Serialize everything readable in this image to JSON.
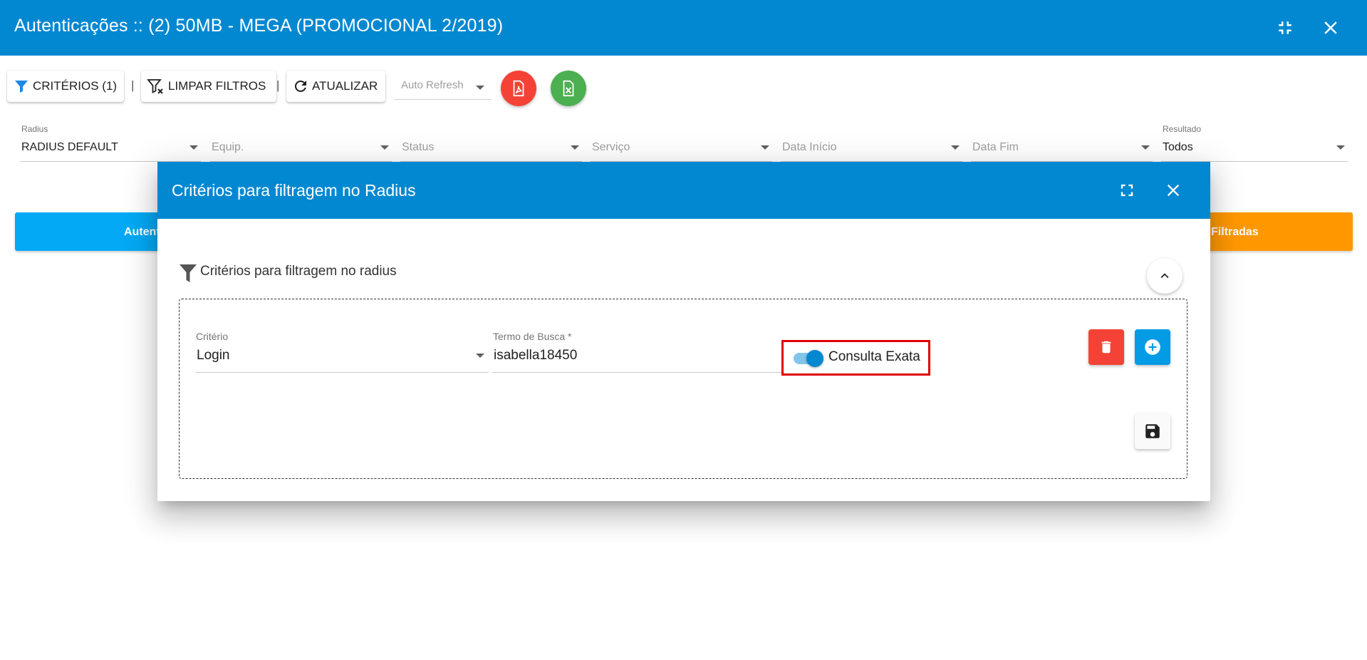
{
  "window": {
    "title": "Autenticações :: (2) 50MB - MEGA (PROMOCIONAL 2/2019)",
    "minimize_icon": "compress-icon",
    "close_icon": "close-icon"
  },
  "toolbar": {
    "criteria_label": "CRITÉRIOS (1)",
    "separator": "|",
    "clear_filters_label": "LIMPAR FILTROS",
    "refresh_label": "ATUALIZAR",
    "auto_refresh_placeholder": "Auto Refresh",
    "pdf_icon": "pdf-icon",
    "excel_icon": "excel-icon",
    "colors": {
      "pdf": "#f44336",
      "excel": "#4caf50",
      "filter_icon": "#1e88e5"
    }
  },
  "filters": {
    "radius": {
      "label": "Radius",
      "value": "RADIUS DEFAULT"
    },
    "equip": {
      "placeholder": "Equip."
    },
    "status": {
      "placeholder": "Status"
    },
    "servico": {
      "placeholder": "Serviço"
    },
    "data_inicio": {
      "placeholder": "Data Início"
    },
    "data_fim": {
      "placeholder": "Data Fim"
    },
    "resultado": {
      "label": "Resultado",
      "value": "Todos"
    }
  },
  "summary": {
    "left_label": "Autent",
    "right_label": "Filtradas",
    "colors": {
      "left": "#03a9f4",
      "right": "#ff9800"
    }
  },
  "dialog": {
    "title": "Critérios para filtragem no Radius",
    "section_title": "Critérios para filtragem no radius",
    "criterio": {
      "label": "Critério",
      "value": "Login"
    },
    "termo": {
      "label": "Termo de Busca *",
      "value": "isabella18450"
    },
    "toggle": {
      "label": "Consulta Exata",
      "checked": true
    },
    "colors": {
      "header": "#0288d1",
      "delete": "#f44336",
      "add": "#039be5",
      "highlight": "#e00000"
    }
  }
}
